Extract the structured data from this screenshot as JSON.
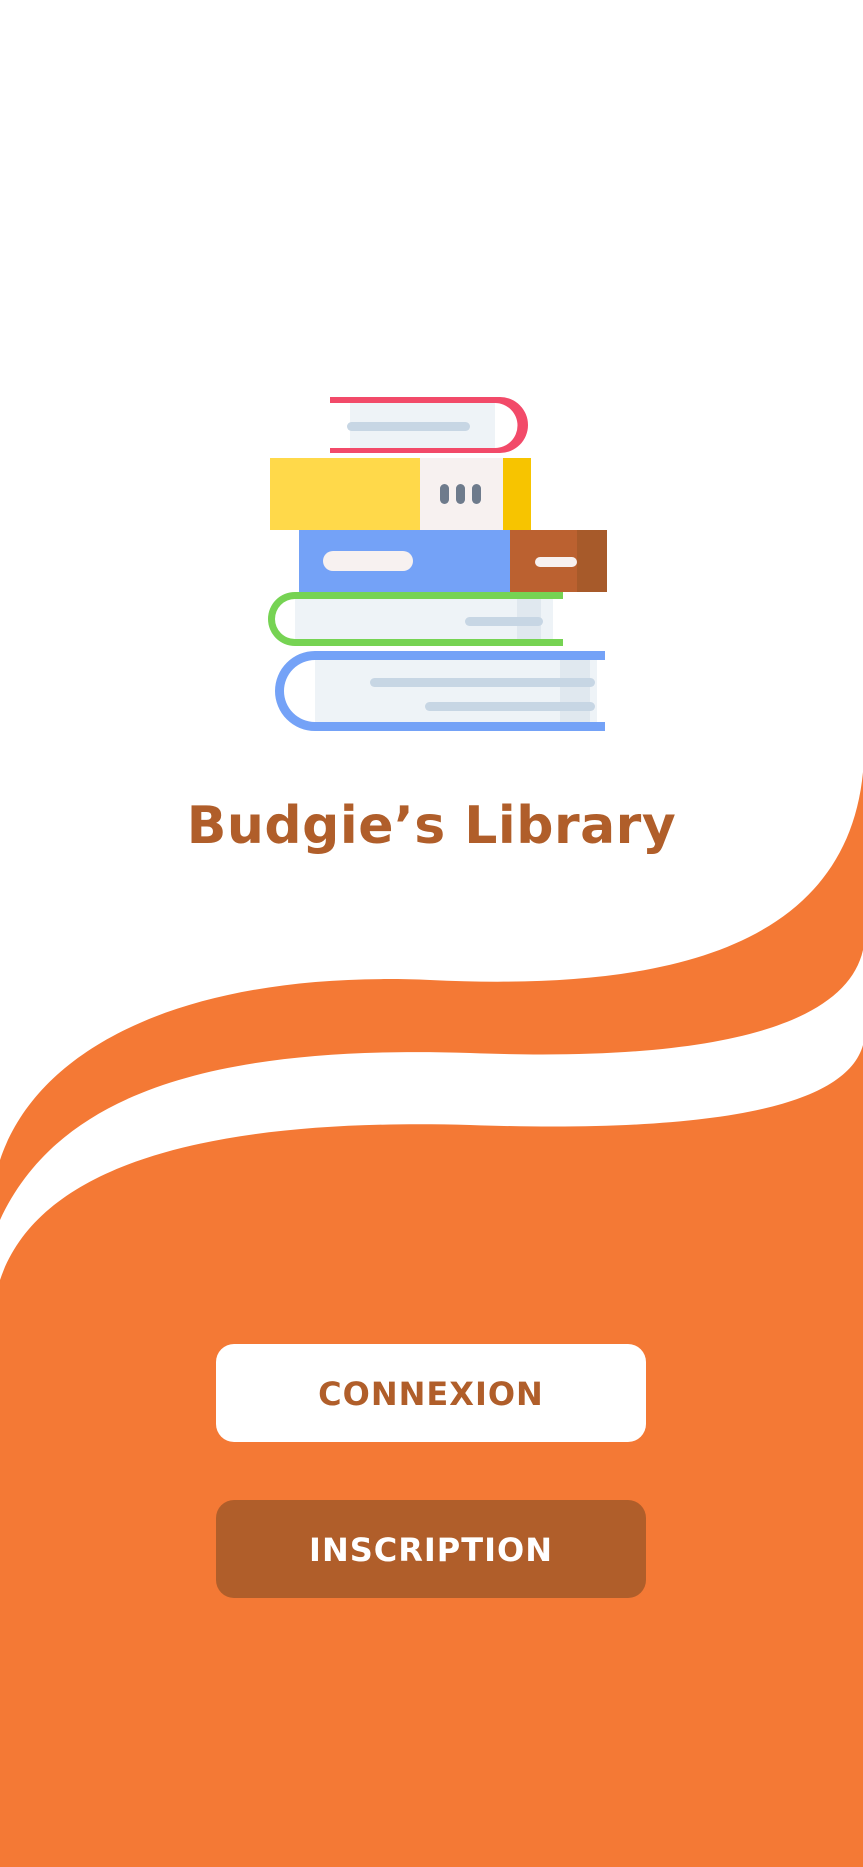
{
  "app": {
    "title": "Budgie’s Library",
    "logo_icon": "books-stack-icon"
  },
  "actions": {
    "login_label": "CONNEXION",
    "signup_label": "INSCRIPTION"
  },
  "colors": {
    "brand_orange": "#f47935",
    "brand_brown": "#b05e2a",
    "background": "#ffffff"
  }
}
